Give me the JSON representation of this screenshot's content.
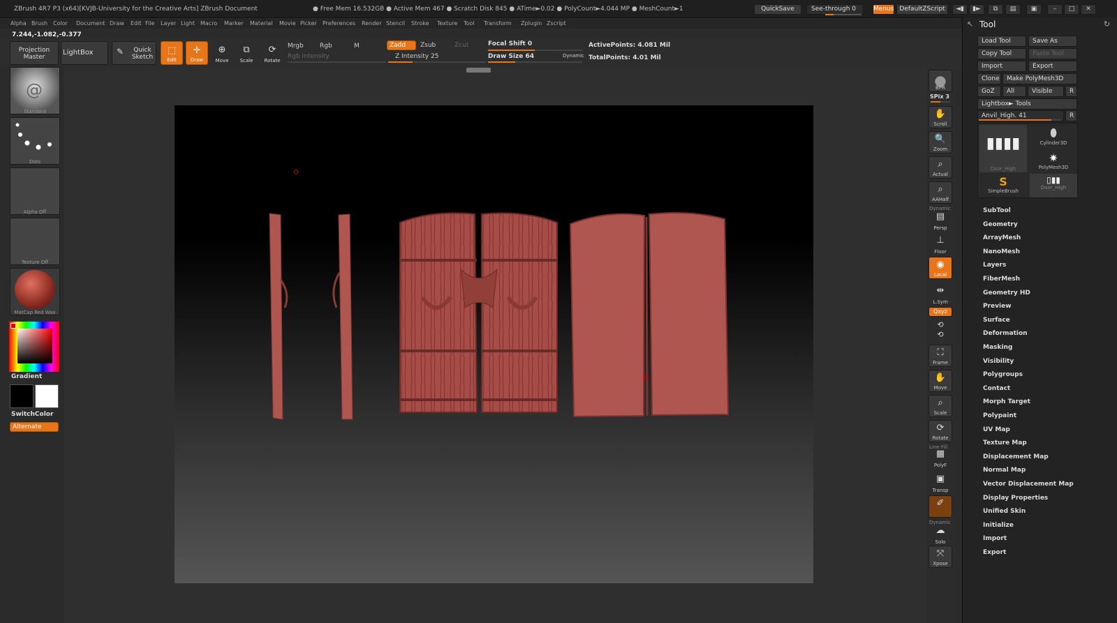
{
  "title_bar": {
    "app_title": "ZBrush 4R7 P3 (x64)[KVJB-University for the Creative Arts]   ZBrush Document",
    "stats": "● Free Mem 16.532GB ● Active Mem 467 ● Scratch Disk 845 ●  ATime►0.02 ● PolyCount►4.044 MP  ● MeshCount►1",
    "quicksave": "QuickSave",
    "see_through": "See-through  0",
    "see_through_level": 0,
    "menus": "Menus",
    "script": "DefaultZScript"
  },
  "menu": [
    "Alpha",
    "Brush",
    "Color",
    "Document",
    "Draw",
    "Edit",
    "File",
    "Layer",
    "Light",
    "Macro",
    "Marker",
    "Material",
    "Movie",
    "Picker",
    "Preferences",
    "Render",
    "Stencil",
    "Stroke",
    "Texture",
    "Tool",
    "Transform",
    "Zplugin",
    "Zscript"
  ],
  "coords": "7.244,-1.082,-0.377",
  "shelf": {
    "projection_master": "Projection Master",
    "lightbox": "LightBox",
    "quick_sketch": "Quick Sketch",
    "edit": "Edit",
    "draw": "Draw",
    "move": "Move",
    "scale": "Scale",
    "rotate": "Rotate",
    "mrgb": "Mrgb",
    "rgb": "Rgb",
    "m": "M",
    "rgb_intensity": "Rgb Intensity",
    "zadd": "Zadd",
    "zsub": "Zsub",
    "zcut": "Zcut",
    "z_intensity": "Z Intensity 25",
    "z_intensity_value": 25,
    "focal_shift": "Focal Shift 0",
    "focal_shift_value": 0,
    "draw_size": "Draw Size 64",
    "draw_size_value": 64,
    "dynamic": "Dynamic",
    "active_points": "ActivePoints: 4.081  Mil",
    "total_points": "TotalPoints: 4.01  Mil"
  },
  "left": {
    "brush": "Standard",
    "stroke": "Dots",
    "alpha": "Alpha  Off",
    "texture": "Texture  Off",
    "material": "MatCap  Red  Wax",
    "gradient": "Gradient",
    "switch_color": "SwitchColor",
    "alternate": "Alternate"
  },
  "right_bar": [
    {
      "label": "BPR"
    },
    {
      "label": "SPix 3"
    },
    {
      "label": "Scroll"
    },
    {
      "label": "Zoom"
    },
    {
      "label": "Actual"
    },
    {
      "label": "AAHalf"
    },
    {
      "label": "Persp"
    },
    {
      "label": "Floor"
    },
    {
      "label": "Local"
    },
    {
      "label": "L.Sym"
    },
    {
      "label": "Qxyz"
    },
    {
      "label": "Frame"
    },
    {
      "label": "Move"
    },
    {
      "label": "Scale"
    },
    {
      "label": "Rotate"
    },
    {
      "label": "PolyF"
    },
    {
      "label": "Transp"
    },
    {
      "label": "Solo"
    },
    {
      "label": "Xpose"
    },
    {
      "label": "Dynamic"
    },
    {
      "label": "Line Fill"
    }
  ],
  "tool_panel": {
    "title": "Tool",
    "load_tool": "Load Tool",
    "save_as": "Save As",
    "copy_tool": "Copy Tool",
    "paste_tool": "Paste Tool",
    "import": "Import",
    "export": "Export",
    "clone": "Clone",
    "make_polymesh": "Make PolyMesh3D",
    "goz": "GoZ",
    "all": "All",
    "visible": "Visible",
    "r": "R",
    "lightbox_tools": "Lightbox► Tools",
    "current_tool": "Anvil_High. 41",
    "thumbs": {
      "door_high": "Door_High",
      "cylinder": "Cylinder3D",
      "polymesh": "PolyMesh3D",
      "simplebrush": "SimpleBrush",
      "door_high2": "Door_High"
    },
    "sections": [
      "SubTool",
      "Geometry",
      "ArrayMesh",
      "NanoMesh",
      "Layers",
      "FiberMesh",
      "Geometry HD",
      "Preview",
      "Surface",
      "Deformation",
      "Masking",
      "Visibility",
      "Polygroups",
      "Contact",
      "Morph Target",
      "Polypaint",
      "UV Map",
      "Texture Map",
      "Displacement Map",
      "Normal Map",
      "Vector Displacement Map",
      "Display Properties",
      "Unified Skin",
      "Initialize",
      "Import",
      "Export"
    ]
  },
  "colors": {
    "accent": "#e8751a",
    "mesh": "#b05650",
    "mesh_dark": "#7a3330"
  }
}
